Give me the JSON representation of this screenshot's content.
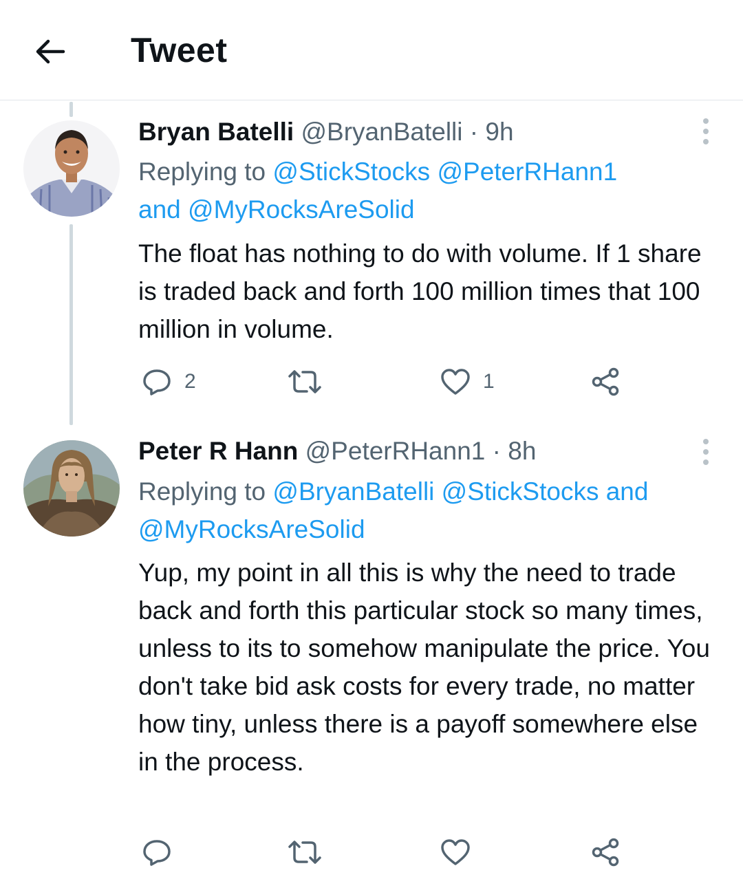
{
  "header": {
    "title": "Tweet",
    "back_icon": "arrow-left-icon"
  },
  "tweets": [
    {
      "author_name": "Bryan Batelli",
      "author_handle": "@BryanBatelli",
      "separator": "·",
      "time": "9h",
      "replying_prefix": "Replying to",
      "mentions": [
        "@StickStocks",
        "@PeterRHann1",
        "@MyRocksAreSolid"
      ],
      "conjunction": "and",
      "text": "The float has nothing to do with volume. If 1 share is traded back and forth 100 million times that 100 million in volume.",
      "reply_count": "2",
      "retweet_count": "",
      "like_count": "1"
    },
    {
      "author_name": "Peter R Hann",
      "author_handle": "@PeterRHann1",
      "separator": "·",
      "time": "8h",
      "replying_prefix": "Replying to",
      "mentions": [
        "@BryanBatelli",
        "@StickStocks",
        "@MyRocksAreSolid"
      ],
      "conjunction": "and",
      "text": "Yup, my point in all this is why the need to trade back and forth this particular stock so many times, unless to its to somehow manipulate the price. You don't take bid ask costs for every trade, no matter how tiny, unless there is a payoff somewhere else in the process.",
      "reply_count": "",
      "retweet_count": "",
      "like_count": ""
    }
  ],
  "colors": {
    "link": "#1d9bf0",
    "secondary": "#536471",
    "primary": "#0f1419",
    "thread_line": "#cfd9de"
  }
}
